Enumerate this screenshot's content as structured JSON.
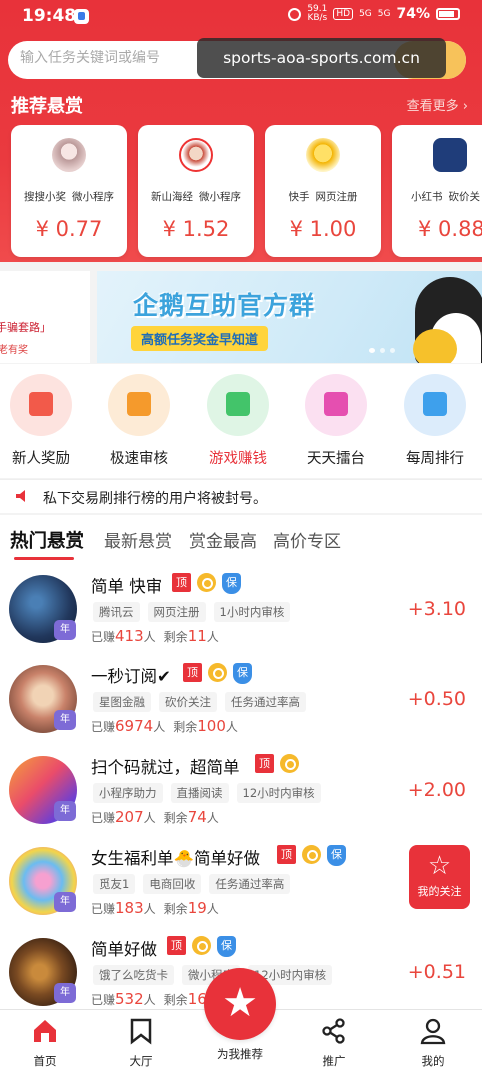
{
  "status_bar": {
    "time": "19:48",
    "speed_value": "59.1",
    "speed_unit": "KB/s",
    "hd": "HD",
    "net1": "5G",
    "net2": "5G",
    "battery": "74%"
  },
  "search": {
    "placeholder": "输入任务关键词或编号"
  },
  "watermark": "sports-aoa-sports.com.cn",
  "recommended": {
    "title": "推荐悬赏",
    "more": "查看更多 ›",
    "cards": [
      {
        "tag1": "搜搜小奖",
        "tag2": "微小程序",
        "price": "¥ 0.77"
      },
      {
        "tag1": "新山海经",
        "tag2": "微小程序",
        "price": "¥ 1.52"
      },
      {
        "tag1": "快手",
        "tag2": "网页注册",
        "price": "¥ 1.00"
      },
      {
        "tag1": "小红书",
        "tag2": "砍价关",
        "price": "¥ 0.88"
      }
    ]
  },
  "banner": {
    "left_line1": "手骗套路」",
    "left_line2": "老有奖",
    "title": "企鹅互助官方群",
    "subtitle": "高额任务奖金早知道"
  },
  "quick_entries": [
    {
      "label": "新人奖励",
      "color": "#f25a4a",
      "bg": "#fde3df",
      "active": false
    },
    {
      "label": "极速审核",
      "color": "#f59a2c",
      "bg": "#fdebd6",
      "active": false
    },
    {
      "label": "游戏赚钱",
      "color": "#43c46a",
      "bg": "#dff5e5",
      "active": true
    },
    {
      "label": "天天擂台",
      "color": "#e54fb0",
      "bg": "#fbe0f1",
      "active": false
    },
    {
      "label": "每周排行",
      "color": "#3ea0ec",
      "bg": "#dcecfb",
      "active": false
    }
  ],
  "notice": "私下交易刷排行榜的用户将被封号。",
  "tabs": [
    "热门悬赏",
    "最新悬赏",
    "赏金最高",
    "高价专区"
  ],
  "tasks": [
    {
      "title": "简单 快审",
      "badges": [
        "顶",
        "coin",
        "保"
      ],
      "tags": [
        "腾讯云",
        "网页注册",
        "1小时内审核"
      ],
      "earned_label": "已赚",
      "earned": "413",
      "earned_unit": "人",
      "remain_label": "剩余",
      "remain": "11",
      "remain_unit": "人",
      "price": "+3.10",
      "year": "年"
    },
    {
      "title": "一秒订阅✔",
      "badges": [
        "顶",
        "coin",
        "保"
      ],
      "tags": [
        "星图金融",
        "砍价关注",
        "任务通过率高"
      ],
      "earned_label": "已赚",
      "earned": "6974",
      "earned_unit": "人",
      "remain_label": "剩余",
      "remain": "100",
      "remain_unit": "人",
      "price": "+0.50",
      "year": "年"
    },
    {
      "title": "扫个码就过，超简单",
      "badges": [
        "顶",
        "coin"
      ],
      "tags": [
        "小程序助力",
        "直播阅读",
        "12小时内审核"
      ],
      "earned_label": "已赚",
      "earned": "207",
      "earned_unit": "人",
      "remain_label": "剩余",
      "remain": "74",
      "remain_unit": "人",
      "price": "+2.00",
      "year": "年"
    },
    {
      "title": "女生福利单🐣简单好做",
      "badges": [
        "顶",
        "coin",
        "保"
      ],
      "tags": [
        "觅友1",
        "电商回收",
        "任务通过率高"
      ],
      "earned_label": "已赚",
      "earned": "183",
      "earned_unit": "人",
      "remain_label": "剩余",
      "remain": "19",
      "remain_unit": "人",
      "price": "",
      "year": "年"
    },
    {
      "title": "简单好做",
      "badges": [
        "顶",
        "coin",
        "保"
      ],
      "tags": [
        "饿了么吃货卡",
        "微小程序",
        "12小时内审核"
      ],
      "earned_label": "已赚",
      "earned": "532",
      "earned_unit": "人",
      "remain_label": "剩余",
      "remain": "16",
      "remain_unit": "",
      "price": "+0.51",
      "year": "年"
    }
  ],
  "follow": {
    "label": "我的关注"
  },
  "nav": [
    {
      "label": "首页",
      "icon": "home-icon"
    },
    {
      "label": "大厅",
      "icon": "bookmark-icon"
    },
    {
      "label": "为我推荐",
      "icon": "star-icon"
    },
    {
      "label": "推广",
      "icon": "share-icon"
    },
    {
      "label": "我的",
      "icon": "user-icon"
    }
  ],
  "colors": {
    "brand_red": "#e8323a",
    "price_red": "#e9463d",
    "gold": "#f6b92b",
    "blue": "#3b8fe6"
  }
}
